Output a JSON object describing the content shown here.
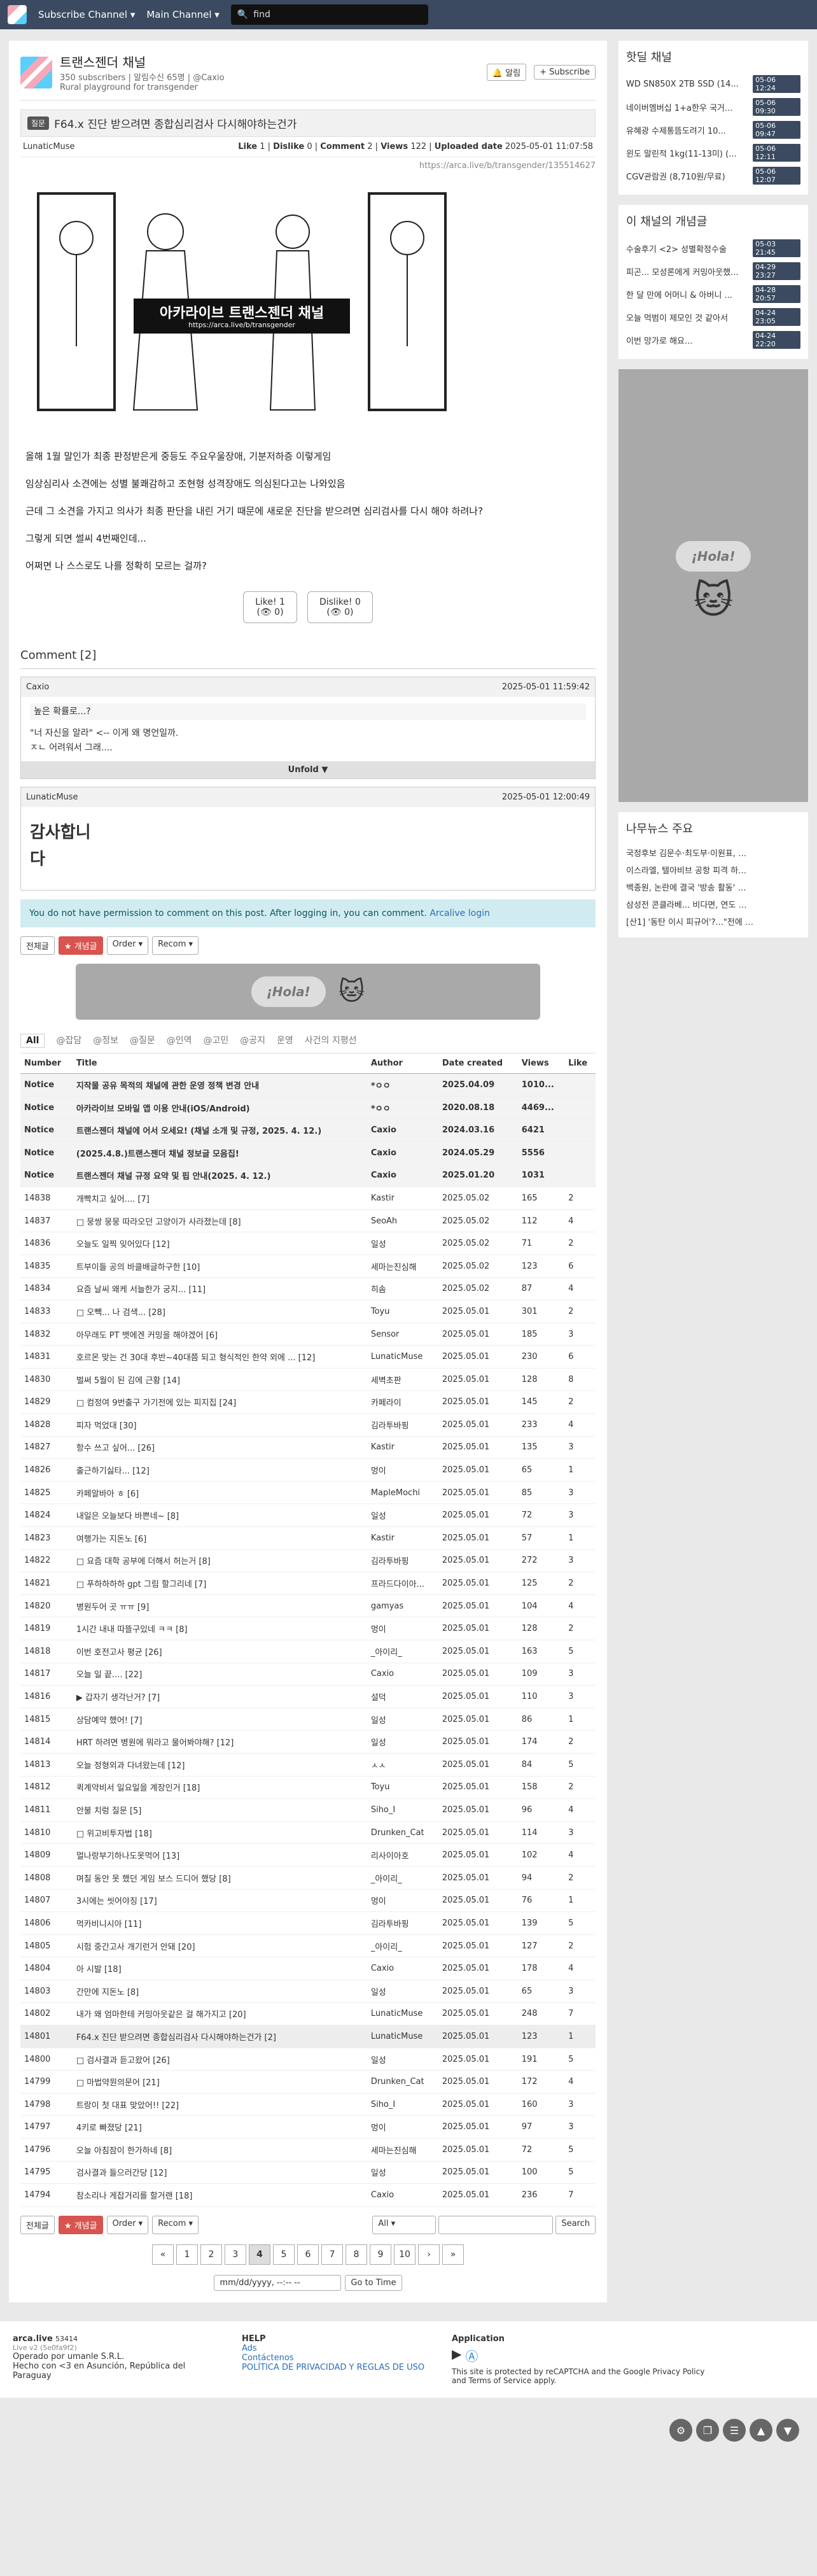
{
  "nav": {
    "subscribe": "Subscribe Channel ▾",
    "main": "Main Channel ▾",
    "search_placeholder": "find"
  },
  "board": {
    "title": "트랜스젠더 채널",
    "meta": "350 subscribers | 알림수신 65명 | @Caxio",
    "desc": "Rural playground for transgender",
    "alarm": "알림",
    "subscribe": "+ Subscribe"
  },
  "post": {
    "category": "질문",
    "title": "F64.x 진단 받으려면 종합심리검사 다시해야하는건가",
    "author": "LunaticMuse",
    "like_label": "Like",
    "like": "1",
    "dislike_label": "Dislike",
    "dislike": "0",
    "comment_label": "Comment",
    "comment": "2",
    "views_label": "Views",
    "views": "122",
    "uploaded_label": "Uploaded date",
    "uploaded": "2025-05-01 11:07:58",
    "url": "https://arca.live/b/transgender/135514627",
    "image_caption": "아카라이브 트랜스젠더 채널",
    "image_url": "https://arca.live/b/transgender",
    "paragraphs": [
      "올해 1월 말인가 최종 판정받은게 중등도 주요우울장애, 기분저하증 이렇게임",
      "임상심리사 소견에는 성별 불쾌감하고 조현형 성격장애도 의심된다고는 나와있음",
      "근데 그 소견을 가지고 의사가 최종 판단을 내린 거기 때문에 새로운 진단을 받으려면 심리검사를 다시 해야 하려나?",
      "그렇게 되면 썰씨 4번째인데...",
      "어쩌면 나 스스로도 나를 정확히 모르는 걸까?"
    ],
    "like_btn": "Like!",
    "dislike_btn": "Dislike!",
    "like_sub": "(👁 0)",
    "dislike_sub": "(👁 0)"
  },
  "comments": {
    "title": "Comment [2]",
    "items": [
      {
        "author": "Caxio",
        "time": "2025-05-01 11:59:42",
        "quote": "높은 확률로...?",
        "lines": [
          "\"너 자신을 알라\" <-- 이게 왜 명언일까.",
          "ㅈㄴ 어려워서 그래...."
        ],
        "unfold": "Unfold ▼"
      },
      {
        "author": "LunaticMuse",
        "time": "2025-05-01 12:00:49",
        "sticker": "감사합니다"
      }
    ],
    "no_permission": "You do not have permission to comment on this post. After logging in, you can comment.",
    "login": "Arcalive login"
  },
  "toolbar": {
    "all": "전체글",
    "best": "★ 개념글",
    "order": "Order ▾",
    "recom": "Recom ▾"
  },
  "ad": {
    "hola": "¡Hola!"
  },
  "categories": [
    "All",
    "@잡담",
    "@정보",
    "@질문",
    "@인역",
    "@고민",
    "@공지",
    "운영",
    "사건의 지평선"
  ],
  "table": {
    "headers": [
      "Number",
      "Title",
      "Author",
      "Date created",
      "Views",
      "Like"
    ],
    "rows": [
      [
        "Notice",
        "지작물 공유 목적의 채널에 관한 운영 정책 변경 안내",
        "*ㅇㅇ",
        "2025.04.09",
        "1010...",
        ""
      ],
      [
        "Notice",
        "아카라이브 모바일 앱 이용 안내(iOS/Android)",
        "*ㅇㅇ",
        "2020.08.18",
        "4469...",
        ""
      ],
      [
        "Notice",
        "트랜스젠더 채널에 어서 오세요! (채널 소개 및 규정, 2025. 4. 12.)",
        "Caxio",
        "2024.03.16",
        "6421",
        ""
      ],
      [
        "Notice",
        "(2025.4.8.)트랜스젠더 채널 정보글 모음집!",
        "Caxio",
        "2024.05.29",
        "5556",
        ""
      ],
      [
        "Notice",
        "트랜스젠더 채널 규정 요약 및 핍 안내(2025. 4. 12.)",
        "Caxio",
        "2025.01.20",
        "1031",
        ""
      ],
      [
        "14838",
        "개빡치고 싶어.... [7]",
        "Kastir",
        "2025.05.02",
        "165",
        "2"
      ],
      [
        "14837",
        "□ 뭉쌍 뭉뭉 따라오던 고양이가 사라졌는데 [8]",
        "SeoAh",
        "2025.05.02",
        "112",
        "4"
      ],
      [
        "14836",
        "오늘도 일찍 잊어있다 [12]",
        "일성",
        "2025.05.02",
        "71",
        "2"
      ],
      [
        "14835",
        "트부이들 공의 바클배글하구한 [10]",
        "세마는진심해",
        "2025.05.02",
        "123",
        "6"
      ],
      [
        "14834",
        "요즘 날씨 왜케 서늘한가 궁지... [11]",
        "히솜",
        "2025.05.02",
        "87",
        "4"
      ],
      [
        "14833",
        "□ 오빽... 나 검색... [28]",
        "Toyu",
        "2025.05.01",
        "301",
        "2"
      ],
      [
        "14832",
        "아무래도 PT 뱃에겐 커밍을 해야겠어 [6]",
        "Sensor",
        "2025.05.01",
        "185",
        "3"
      ],
      [
        "14831",
        "호르몬 맞는 건 30대 후반~40대쯤 되고 형식적인 한약 외에 ... [12]",
        "LunaticMuse",
        "2025.05.01",
        "230",
        "6"
      ],
      [
        "14830",
        "벌써 5월이 된 김에 근황 [14]",
        "세벽초판",
        "2025.05.01",
        "128",
        "8"
      ],
      [
        "14829",
        "□ 컴정여 9번출구 가기전에 있는 피지집 [24]",
        "카페라이",
        "2025.05.01",
        "145",
        "2"
      ],
      [
        "14828",
        "피자 먹었대 [30]",
        "김라투바핑",
        "2025.05.01",
        "233",
        "4"
      ],
      [
        "14827",
        "항수 쓰고 싶어... [26]",
        "Kastir",
        "2025.05.01",
        "135",
        "3"
      ],
      [
        "14826",
        "출근하기싫타... [12]",
        "멍이",
        "2025.05.01",
        "65",
        "1"
      ],
      [
        "14825",
        "카페알바아 ㅎ [6]",
        "MapleMochi",
        "2025.05.01",
        "85",
        "3"
      ],
      [
        "14824",
        "내일은 오늘보다 바쁜네~ [8]",
        "일성",
        "2025.05.01",
        "72",
        "3"
      ],
      [
        "14823",
        "여행가는 지돈노 [6]",
        "Kastir",
        "2025.05.01",
        "57",
        "1"
      ],
      [
        "14822",
        "□ 요즘 대학 공부에 더해서 허는거 [8]",
        "김라투바핑",
        "2025.05.01",
        "272",
        "3"
      ],
      [
        "14821",
        "□ 푸하하하하 gpt 그림 할그리네 [7]",
        "프라드다이아...",
        "2025.05.01",
        "125",
        "2"
      ],
      [
        "14820",
        "병원두어 곳 ㅠㅠ [9]",
        "gamyas",
        "2025.05.01",
        "104",
        "4"
      ],
      [
        "14819",
        "1시간 내내 따뜰구있네 ㅋㅋ [8]",
        "멍이",
        "2025.05.01",
        "128",
        "2"
      ],
      [
        "14818",
        "이번 호전고사 평균 [26]",
        "_아이리_",
        "2025.05.01",
        "163",
        "5"
      ],
      [
        "14817",
        "오늘 일 끝.... [22]",
        "Caxio",
        "2025.05.01",
        "109",
        "3"
      ],
      [
        "14816",
        "▶ 갑자기 생각난거? [7]",
        "설덕",
        "2025.05.01",
        "110",
        "3"
      ],
      [
        "14815",
        "상담예약 했어! [7]",
        "일성",
        "2025.05.01",
        "86",
        "1"
      ],
      [
        "14814",
        "HRT 하려면 병원에 뭐라고 물어봐야해? [12]",
        "일성",
        "2025.05.01",
        "174",
        "2"
      ],
      [
        "14813",
        "오늘 정형외과 다녀왔는데 [12]",
        "ㅅㅅ",
        "2025.05.01",
        "84",
        "5"
      ],
      [
        "14812",
        "퀵계약비서 일요일을 계장인거 [18]",
        "Toyu",
        "2025.05.01",
        "158",
        "2"
      ],
      [
        "14811",
        "안불 치렁 질문 [5]",
        "Siho_I",
        "2025.05.01",
        "96",
        "4"
      ],
      [
        "14810",
        "□ 위고비투자법 [18]",
        "Drunken_Cat",
        "2025.05.01",
        "114",
        "3"
      ],
      [
        "14809",
        "멀나랑부기하나도못먹어 [13]",
        "리사이아호",
        "2025.05.01",
        "102",
        "4"
      ],
      [
        "14808",
        "며칠 동안 못 했던 게임 보스 드디어 했당 [8]",
        "_아이리_",
        "2025.05.01",
        "94",
        "2"
      ],
      [
        "14807",
        "3시에는 씻어야징 [17]",
        "멍이",
        "2025.05.01",
        "76",
        "1"
      ],
      [
        "14806",
        "먹카비니시아 [11]",
        "김라투바핑",
        "2025.05.01",
        "139",
        "5"
      ],
      [
        "14805",
        "시험 중간고사 개기런거 안돼 [20]",
        "_아이리_",
        "2025.05.01",
        "127",
        "2"
      ],
      [
        "14804",
        "아 시발 [18]",
        "Caxio",
        "2025.05.01",
        "178",
        "4"
      ],
      [
        "14803",
        "간만에 지돈노 [8]",
        "일성",
        "2025.05.01",
        "65",
        "3"
      ],
      [
        "14802",
        "내가 왜 엄마한테 커밍아웃같은 걸 해가지고 [20]",
        "LunaticMuse",
        "2025.05.01",
        "248",
        "7"
      ],
      [
        "14801",
        "F64.x 진단 받으려면 종합심리검사 다시해야하는건가 [2]",
        "LunaticMuse",
        "2025.05.01",
        "123",
        "1"
      ],
      [
        "14800",
        "□ 검사결과 듣고왔어 [26]",
        "일성",
        "2025.05.01",
        "191",
        "5"
      ],
      [
        "14799",
        "□ 마법약뭔의문어 [21]",
        "Drunken_Cat",
        "2025.05.01",
        "172",
        "4"
      ],
      [
        "14798",
        "트랑이 첫 대표 맞았어!! [22]",
        "Siho_I",
        "2025.05.01",
        "160",
        "3"
      ],
      [
        "14797",
        "4키로 빠졌당 [21]",
        "멍이",
        "2025.05.01",
        "97",
        "3"
      ],
      [
        "14796",
        "오늘 아침잠이 한가하네 [8]",
        "세마는진심해",
        "2025.05.01",
        "72",
        "5"
      ],
      [
        "14795",
        "검사결과 들으러간당 [12]",
        "일성",
        "2025.05.01",
        "100",
        "5"
      ],
      [
        "14794",
        "참소리나 게잡거리를 할거랜 [18]",
        "Caxio",
        "2025.05.01",
        "236",
        "7"
      ]
    ]
  },
  "search": {
    "scope": "All ▾",
    "button": "Search"
  },
  "pager": [
    "«",
    "1",
    "2",
    "3",
    "4",
    "5",
    "6",
    "7",
    "8",
    "9",
    "10",
    "›",
    "»"
  ],
  "goto": {
    "placeholder": "mm/dd/yyyy, --:-- --",
    "button": "Go to Time"
  },
  "side": {
    "hot_title": "핫딜 채널",
    "hot": [
      [
        "WD SN850X 2TB SSD (14...",
        "05-06 12:24"
      ],
      [
        "네이버멤버십 1+a한우 국거...",
        "05-06 09:30"
      ],
      [
        "유혜광 수제통뜸도려기 10...",
        "05-06 09:47"
      ],
      [
        "윈도 말린적 1kg(11-13미) (...",
        "05-06 12:11"
      ],
      [
        "CGV관람권 (8,710원/무료)",
        "05-06 12:07"
      ]
    ],
    "concept_title": "이 채널의 개념글",
    "concept": [
      [
        "수술후기 <2> 성별확정수술",
        "05-03 21:45"
      ],
      [
        "피곤... 모성론에게 커밍아웃했...",
        "04-29 23:27"
      ],
      [
        "한 달 만에 어머니 & 아버니 ...",
        "04-28 20:57"
      ],
      [
        "오늘 먹범이 제모인 것 같아서",
        "04-24 23:05"
      ],
      [
        "이번 망가로 해요...",
        "04-24 22:20"
      ]
    ],
    "news_title": "나무뉴스 주요",
    "news": [
      "국정후보 김문수·최도부·이원표, 단일화 종통...",
      "이스라엘, 텔아비브 공항 피격 하루만에 예멘...",
      "백종원, 논란에 결국 '방송 활동' 중단...'기업...",
      "삼성전 콘클라베... 비다면, 연도 네 후대전회 ...",
      "[산1] '동탄 이시 피규어'?...\"전에 중단하라\""
    ]
  },
  "footer": {
    "brand": "arca.live",
    "users": "53414",
    "version": "Live v2 (5e0fa9f2)",
    "operator": "Operado por umanle S.R.L.",
    "made": "Hecho con <3 en Asunción, República del Paraguay",
    "help": "HELP",
    "ads": "Ads",
    "contact": "Contáctenos",
    "policy": "POLÍTICA DE PRIVACIDAD Y REGLAS DE USO",
    "app": "Application",
    "recaptcha": "This site is protected by reCAPTCHA and the Google Privacy Policy and Terms of Service apply."
  }
}
